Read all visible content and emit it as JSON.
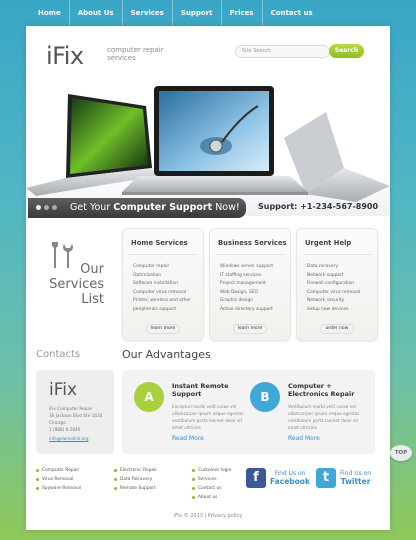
{
  "nav": {
    "items": [
      "Home",
      "About Us",
      "Services",
      "Support",
      "Prices",
      "Contact us"
    ]
  },
  "header": {
    "logo": "iFix",
    "logo_sub": "computer repair services",
    "search_placeholder": "Site Search",
    "search_button": "Search"
  },
  "banner": {
    "text_prefix": "Get Your",
    "text_bold": "Computer Support",
    "text_suffix": "Now!",
    "support": "Support: +1-234-567-8900"
  },
  "services_title": "Our Services List",
  "service_boxes": [
    {
      "title": "Home Services",
      "items": [
        "Computer repair",
        "Optimization",
        "Software installation",
        "Computer virus removal",
        "Printer, wireless and other",
        "peripherals support"
      ],
      "button": "learn more"
    },
    {
      "title": "Business Services",
      "items": [
        "Windows server support",
        "IT staffing services",
        "Project management",
        "Web Design, SEO",
        "Graphic design",
        "Active directory support"
      ],
      "button": "learn more"
    },
    {
      "title": "Urgent Help",
      "items": [
        "Data recovery",
        "Network support",
        "Firewall configuration",
        "Computer virus removal",
        "Network security",
        "Setup new devices"
      ],
      "button": "order now"
    }
  ],
  "contacts": {
    "title": "Contacts",
    "logo": "iFix",
    "lines": [
      "iFix Computer Repair",
      "30 Jackson Blvd Ste 1620",
      "Chicago",
      "1 (888) 6-2840"
    ],
    "email": "info@demolink.org"
  },
  "advantages": {
    "title": "Our Advantages",
    "items": [
      {
        "badge": "A",
        "title": "Instant Remote Support",
        "body": "Excepturi morbi velit curae vel ullamcorper ipsum neque egestas vestibulum porta laoreet dolor sit amet ultricies",
        "more": "Read More"
      },
      {
        "badge": "B",
        "title": "Computer + Electronics Repair",
        "body": "Vestibulum morbi velit curae vel ullamcorper ipsum neque egestas vestibulum porta laoreet dolor sit amet ultricies",
        "more": "Read More"
      }
    ],
    "colors": {
      "a": "#a8cf3c",
      "b": "#3fa8d6",
      "link": "#3a8fc7"
    }
  },
  "footer": {
    "cols": [
      [
        "Computer Repair",
        "Virus Removal",
        "Spyware Removal"
      ],
      [
        "Electronic Repair",
        "Data Recovery",
        "Remote Support"
      ],
      [
        "Customer login",
        "Services",
        "Contact us",
        "About us"
      ]
    ],
    "facebook": {
      "line1": "Find Us on",
      "line2": "Facebook"
    },
    "twitter": {
      "line1": "Find Us on",
      "line2": "Twitter"
    },
    "copyright": "iFix © 2013 | Privacy policy",
    "top": "TOP"
  }
}
